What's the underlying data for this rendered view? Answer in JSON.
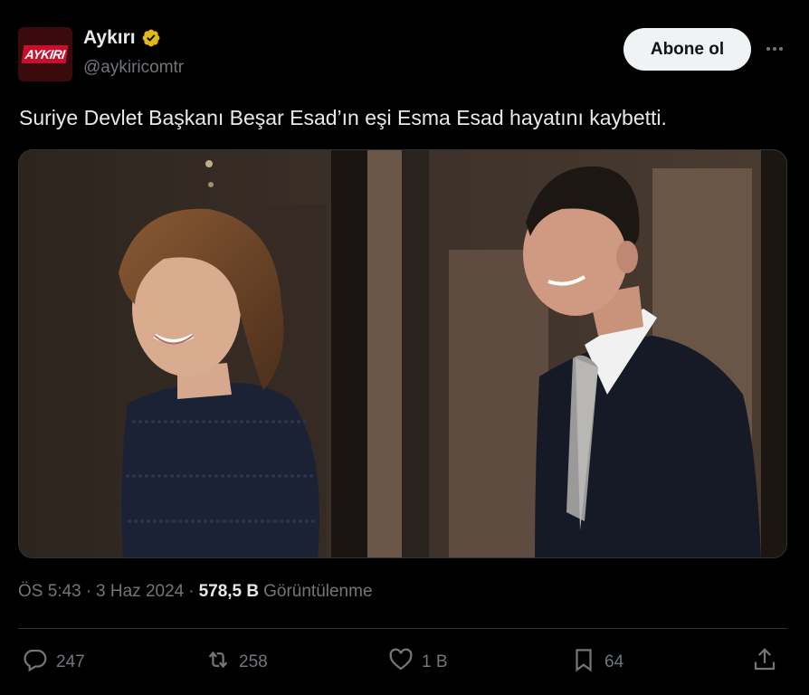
{
  "author": {
    "avatar_logo": "AYKIRI",
    "name": "Aykırı",
    "handle": "@aykiricomtr",
    "verified_color": "#e2b719"
  },
  "subscribe_label": "Abone ol",
  "tweet": {
    "text": "Suriye Devlet Başkanı Beşar Esad’ın eşi Esma Esad hayatını kaybetti.",
    "time": "ÖS 5:43",
    "date": "3 Haz 2024",
    "views": "578,5 B",
    "views_label": "Görüntülenme",
    "separator": "·"
  },
  "actions": {
    "replies": "247",
    "reposts": "258",
    "likes": "1 B",
    "bookmarks": "64"
  },
  "icons": {
    "more": "more-icon",
    "reply": "reply-icon",
    "repost": "repost-icon",
    "like": "heart-icon",
    "bookmark": "bookmark-icon",
    "share": "share-icon"
  }
}
